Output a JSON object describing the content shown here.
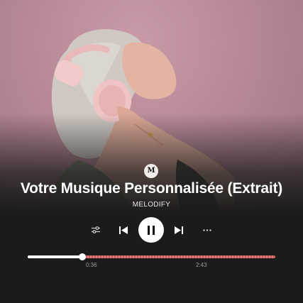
{
  "track": {
    "title": "Votre Musique Personnalisée (Extrait)",
    "artist": "MELODIFY",
    "logo_letter": "M"
  },
  "cover": {
    "icon": "cover-art-woman-with-headphones",
    "background_color": "#b88896"
  },
  "controls": {
    "settings_icon": "sliders-icon",
    "previous_icon": "skip-previous-icon",
    "pause_icon": "pause-icon",
    "next_icon": "skip-next-icon",
    "more_icon": "more-horizontal-icon"
  },
  "playback": {
    "elapsed": "0:36",
    "total": "2:43",
    "progress_fraction": 0.22,
    "played_color": "#ffffff",
    "remaining_color": "#e07a7a"
  }
}
